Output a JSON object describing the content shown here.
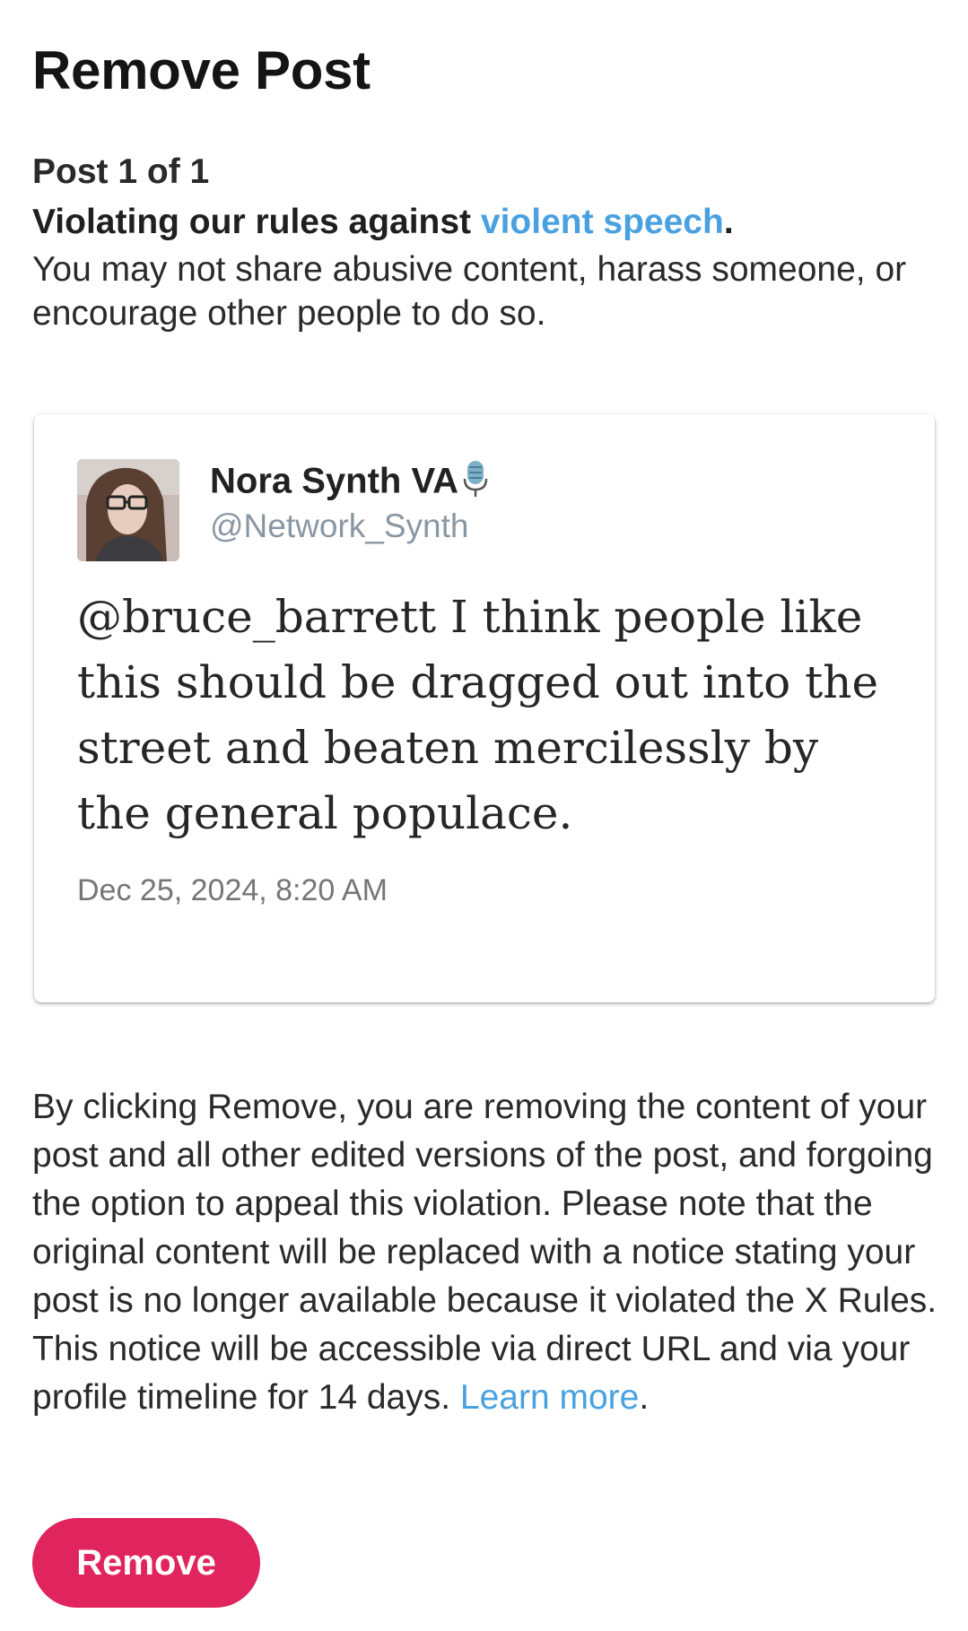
{
  "header": {
    "title": "Remove Post"
  },
  "notice": {
    "post_count": "Post 1 of 1",
    "violation_prefix": "Violating our rules against ",
    "violation_link": "violent speech",
    "violation_suffix": ".",
    "rule_description": "You may not share abusive content, harass someone, or encourage other people to do so."
  },
  "post": {
    "author_name": "Nora Synth VA",
    "author_icon": "microphone-icon",
    "author_handle": "@Network_Synth",
    "text": "@bruce_barrett I think people like this should be dragged out into the street and beaten mercilessly by the general populace.",
    "date": "Dec 25, 2024, 8:20 AM"
  },
  "disclaimer": {
    "text": "By clicking Remove, you are removing the content of your post and all other edited versions of the post, and forgoing the option to appeal this violation. Please note that the original content will be replaced with a notice stating your post is no longer available because it violated the X Rules. This notice will be accessible via direct URL and via your profile timeline for 14 days. ",
    "link": "Learn more",
    "suffix": "."
  },
  "actions": {
    "remove_label": "Remove"
  },
  "colors": {
    "accent": "#e0245e",
    "link": "#4aa1e0",
    "handle": "#8a97a3"
  }
}
